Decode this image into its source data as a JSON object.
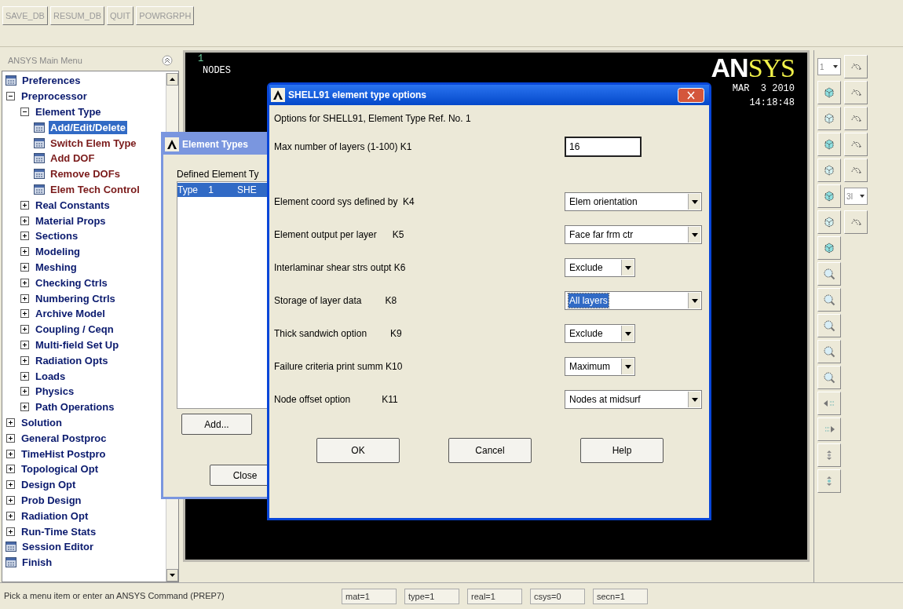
{
  "toolbar": {
    "buttons": [
      "SAVE_DB",
      "RESUM_DB",
      "QUIT",
      "POWRGRPH"
    ]
  },
  "main_menu": {
    "title": "ANSYS Main Menu",
    "items": [
      {
        "label": "Preferences",
        "kind": "leaf",
        "color": "#0a1a6e",
        "selected": false
      },
      {
        "label": "Preprocessor",
        "kind": "group",
        "expanded": true,
        "children": [
          {
            "label": "Element Type",
            "kind": "group",
            "expanded": true,
            "children": [
              {
                "label": "Add/Edit/Delete",
                "kind": "leaf",
                "selected": true
              },
              {
                "label": "Switch Elem Type",
                "kind": "leaf",
                "color": "#7a1a1a",
                "selected": false
              },
              {
                "label": "Add DOF",
                "kind": "leaf",
                "color": "#7a1a1a",
                "selected": false
              },
              {
                "label": "Remove DOFs",
                "kind": "leaf",
                "color": "#7a1a1a",
                "selected": false
              },
              {
                "label": "Elem Tech Control",
                "kind": "leaf",
                "color": "#7a1a1a",
                "selected": false
              }
            ]
          },
          {
            "label": "Real Constants",
            "kind": "group",
            "expanded": false
          },
          {
            "label": "Material Props",
            "kind": "group",
            "expanded": false
          },
          {
            "label": "Sections",
            "kind": "group",
            "expanded": false
          },
          {
            "label": "Modeling",
            "kind": "group",
            "expanded": false
          },
          {
            "label": "Meshing",
            "kind": "group",
            "expanded": false
          },
          {
            "label": "Checking Ctrls",
            "kind": "group",
            "expanded": false
          },
          {
            "label": "Numbering Ctrls",
            "kind": "group",
            "expanded": false
          },
          {
            "label": "Archive Model",
            "kind": "group",
            "expanded": false
          },
          {
            "label": "Coupling / Ceqn",
            "kind": "group",
            "expanded": false
          },
          {
            "label": "Multi-field Set Up",
            "kind": "group",
            "expanded": false
          },
          {
            "label": "Radiation Opts",
            "kind": "group",
            "expanded": false
          },
          {
            "label": "Loads",
            "kind": "group",
            "expanded": false
          },
          {
            "label": "Physics",
            "kind": "group",
            "expanded": false
          },
          {
            "label": "Path Operations",
            "kind": "group",
            "expanded": false
          }
        ]
      },
      {
        "label": "Solution",
        "kind": "group",
        "expanded": false
      },
      {
        "label": "General Postproc",
        "kind": "group",
        "expanded": false
      },
      {
        "label": "TimeHist Postpro",
        "kind": "group",
        "expanded": false
      },
      {
        "label": "Topological Opt",
        "kind": "group",
        "expanded": false
      },
      {
        "label": "Design Opt",
        "kind": "group",
        "expanded": false
      },
      {
        "label": "Prob Design",
        "kind": "group",
        "expanded": false
      },
      {
        "label": "Radiation Opt",
        "kind": "group",
        "expanded": false
      },
      {
        "label": "Run-Time Stats",
        "kind": "group",
        "expanded": false
      },
      {
        "label": "Session Editor",
        "kind": "leaf",
        "color": "#0a1a6e",
        "selected": false
      },
      {
        "label": "Finish",
        "kind": "leaf",
        "color": "#0a1a6e",
        "selected": false
      }
    ]
  },
  "graphics": {
    "window_number": "1",
    "label": "NODES",
    "logo_left": "AN",
    "logo_right": "SYS",
    "date": "MAR  3 2010",
    "time": "14:18:48"
  },
  "right_toolbar": {
    "dropdowns": [
      "1",
      "3I"
    ]
  },
  "element_types_dialog": {
    "title": "Element Types",
    "list_label": "Defined Element Ty",
    "rows": [
      {
        "cells": [
          "Type    1",
          "SHE"
        ],
        "selected": true
      }
    ],
    "buttons": [
      "Add...",
      "Close"
    ]
  },
  "options_dialog": {
    "title": "SHELL91 element type options",
    "subtitle": "Options for SHELL91, Element Type Ref. No. 1",
    "options": [
      {
        "label": "Max number of layers (1-100) K1",
        "kind": "text",
        "value": "16"
      },
      {
        "label": "Element coord sys defined by  K4",
        "kind": "dropdown",
        "value": "Elem orientation"
      },
      {
        "label": "Element output per layer      K5",
        "kind": "dropdown",
        "value": "Face far frm ctr"
      },
      {
        "label": "Interlaminar shear strs outpt K6",
        "kind": "short-dropdown",
        "value": "Exclude"
      },
      {
        "label": "Storage of layer data         K8",
        "kind": "dropdown",
        "value": "All layers",
        "focused": true
      },
      {
        "label": "Thick sandwich option         K9",
        "kind": "short-dropdown",
        "value": "Exclude"
      },
      {
        "label": "Failure criteria print summ K10",
        "kind": "short-dropdown",
        "value": "Maximum"
      },
      {
        "label": "Node offset option            K11",
        "kind": "dropdown",
        "value": "Nodes at midsurf"
      }
    ],
    "buttons": [
      "OK",
      "Cancel",
      "Help"
    ]
  },
  "status_bar": {
    "prompt": "Pick a menu item or enter an ANSYS Command (PREP7)",
    "fields": [
      "mat=1",
      "type=1",
      "real=1",
      "csys=0",
      "secn=1"
    ]
  }
}
